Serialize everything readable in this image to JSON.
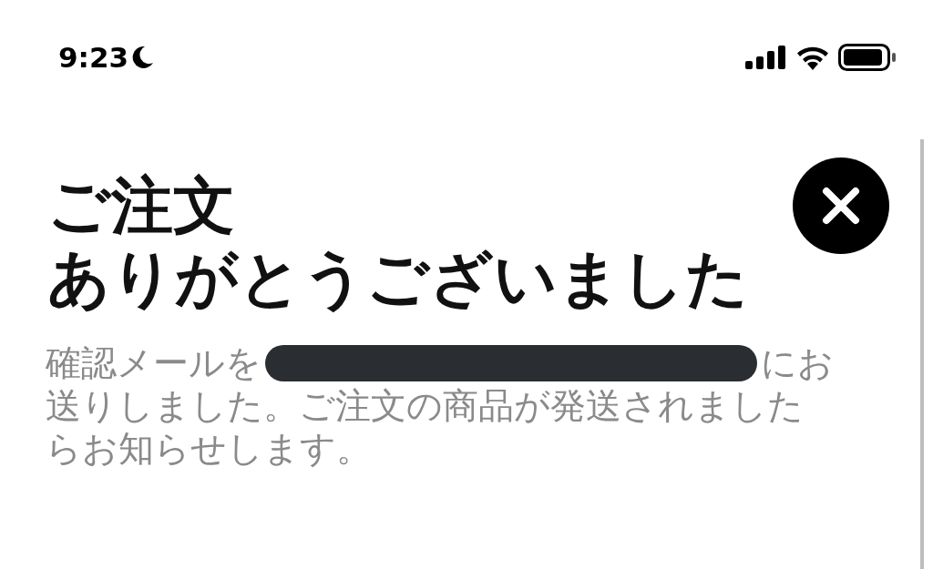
{
  "status_bar": {
    "time": "9:23"
  },
  "title_lines": [
    "ご注文",
    "ありがとうございました"
  ],
  "message": {
    "before": "確認メールを",
    "after_lines": [
      "にお",
      "送りしました。ご注文の商品が発送されました",
      "らお知らせします。"
    ]
  }
}
